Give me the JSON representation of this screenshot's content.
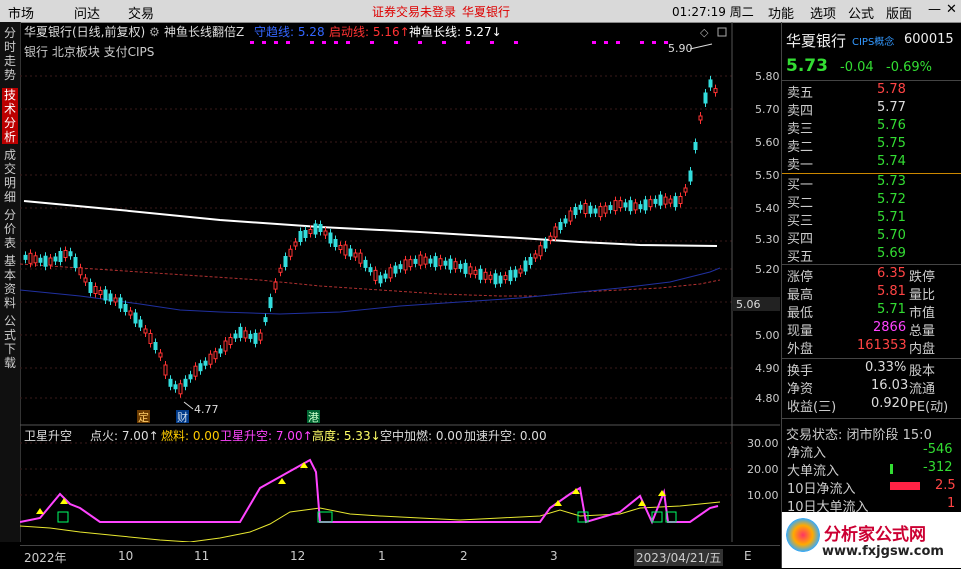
{
  "menu": {
    "market": "市场",
    "ask": "问达",
    "trade": "交易",
    "notice": "证券交易未登录",
    "stock": "华夏银行",
    "clock": "01:27:19 周二",
    "function": "功能",
    "options": "选项",
    "formula": "公式",
    "layout": "版面"
  },
  "sidebar": [
    "分时走势",
    "技术分析",
    "成交明细",
    "分价表",
    "基本资料",
    "公式下载"
  ],
  "header": {
    "title": "华夏银行(日线,前复权)",
    "indicator": "神鱼长线翻倍Z",
    "field1_label": "守趋线: 5.28",
    "field2_label": "启动线: 5.16↑",
    "field3_label": "神鱼长线: 5.27↓",
    "sub": "银行   北京板块   支付CIPS"
  },
  "price_axis": [
    "5.80",
    "5.70",
    "5.60",
    "5.50",
    "5.40",
    "5.30",
    "5.20",
    "5.10",
    "5.00",
    "4.90",
    "4.80"
  ],
  "price_axis_sub": [
    "30.00",
    "20.00",
    "10.00"
  ],
  "labels": {
    "high": "5.90",
    "low": "4.77",
    "axis_marker": "5.06",
    "badge_ding": "定",
    "badge_cai": "财",
    "badge_gang": "港"
  },
  "lower_header": {
    "name": "卫星升空",
    "item1": "点火: 7.00↑",
    "item2": "燃料: 0.00",
    "item3": "卫星升空: 7.00↑",
    "item4": "高度: 5.33↓",
    "item5": "空中加燃: 0.00",
    "item6": "加速升空: 0.00"
  },
  "date_axis": [
    "2022年",
    "10",
    "11",
    "12",
    "1",
    "2",
    "3",
    "2023/04/21/五",
    "E"
  ],
  "quote": {
    "name": "华夏银行",
    "tag": "CIPS概念",
    "code": "600015",
    "price": "5.73",
    "change": "-0.04",
    "pct": "-0.69%",
    "asks": [
      [
        "卖五",
        "5.78"
      ],
      [
        "卖四",
        "5.77"
      ],
      [
        "卖三",
        "5.76"
      ],
      [
        "卖二",
        "5.75"
      ],
      [
        "卖一",
        "5.74"
      ]
    ],
    "bids": [
      [
        "买一",
        "5.73"
      ],
      [
        "买二",
        "5.72"
      ],
      [
        "买三",
        "5.71"
      ],
      [
        "买四",
        "5.70"
      ],
      [
        "买五",
        "5.69"
      ]
    ],
    "stats": [
      [
        "涨停",
        "6.35",
        "跌停"
      ],
      [
        "最高",
        "5.81",
        "量比"
      ],
      [
        "最低",
        "5.71",
        "市值"
      ],
      [
        "现量",
        "2866",
        "总量"
      ],
      [
        "外盘",
        "161353",
        "内盘"
      ]
    ],
    "stats2": [
      [
        "换手",
        "0.33%",
        "股本"
      ],
      [
        "净资",
        "16.03",
        "流通"
      ],
      [
        "收益(三)",
        "0.920",
        "PE(动)"
      ]
    ],
    "state": "交易状态: 闭市阶段 15:0",
    "flows": [
      [
        "净流入",
        "-546"
      ],
      [
        "大单流入",
        "-312"
      ],
      [
        "10日净流入",
        "2.5"
      ],
      [
        "10日大单流入",
        "1"
      ]
    ],
    "logo": "分析家公式网",
    "logo_url": "www.fxjgsw.com"
  }
}
